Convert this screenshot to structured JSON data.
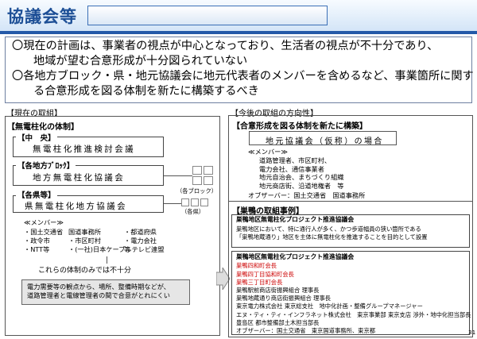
{
  "header": {
    "title": "協議会等"
  },
  "summary": {
    "bullet": "〇",
    "line1": "現在の計画は、事業者の視点が中心となっており、生活者の視点が不十分であり、",
    "line1_cont": "地域が望む合意形成が十分図られていない",
    "line2": "各地方ブロック・県・地元協議会に地元代表者のメンバーを含めるなど、事業箇所に関す",
    "line2_cont": "る合意形成を図る体制を新たに構築するべき"
  },
  "left": {
    "section_label": "【現在の取組】",
    "panel_title": "【無電柱化の体制】",
    "central": {
      "tag": "【中　央】",
      "body": "無電柱化推進検討会議"
    },
    "regional": {
      "tag": "【各地方ﾌﾞﾛｯｸ】",
      "body": "地方無電柱化協議会",
      "note": "（各ブロック）"
    },
    "prefecture": {
      "tag": "【各県等】",
      "body": "県無電柱化地方協議会",
      "note": "（各県）"
    },
    "members": {
      "heading": "≪メンバー≫",
      "rows": [
        [
          "・国土交通省",
          "国道事務所",
          "・都道府県"
        ],
        [
          "・政令市",
          "・市区町村",
          "・電力会社"
        ],
        [
          "・NTT等",
          "・(一社)日本ケーブルテレビ連盟",
          "等"
        ]
      ]
    },
    "insufficient": "これらの体制のみでは不十分",
    "problem_line1": "電力需要等の観点から、場所、整備時期などが、",
    "problem_line2": "道路管理者と電線管理者の間で合意がとれにくい"
  },
  "right": {
    "section_label": "【今後の取組の方向性】",
    "consensus": {
      "title": "【合意形成を図る体制を新たに構築】",
      "council_box": "地元協議会（仮称）の場合",
      "members_heading": "≪メンバー≫",
      "members": [
        "道路管理者、市区町村、",
        "電力会社、通信事業者",
        "地元自治会、まちづくり組織",
        "地元商店街、沿道地権者　等"
      ],
      "observer": "オブザーバー：国土交通省　国道事務所"
    },
    "example": {
      "title": "【巣鴨の取組事例】",
      "box1_title": "巣鴨地区無電柱化プロジェクト推進協議会",
      "box1_line1": "巣鴨地区において、特に通行人が多く、かつ歩道幅員の狭い箇所である",
      "box1_line2": "「巣鴨地蔵通り」地区を主体に無電柱化を推進することを目的として設置",
      "box2_title": "巣鴨地区無電柱化プロジェクト推進協議会",
      "box2_members": [
        "巣鴨四和町会長",
        "巣鴨四丁目協和町会長",
        "巣鴨三丁目町会長",
        "巣鴨駅前商店街振興組合 理事長",
        "巣鴨地蔵通り商店街振興組合 理事長",
        "東京電力株式会社 東京総支社　地中化計画・整備グループマネージャー",
        "エヌ・ティ・ティ・インフラネット株式会社　東京事業部 東京支店 渉外・地中化担当部長",
        "豊島区 都市整備部土木担当部長",
        "オブザーバー：国土交通省　東京国道事務所、東京都"
      ]
    }
  },
  "page_number": "31",
  "colors": {
    "header_blue": "#1d4f96",
    "accent_red": "#cc0000"
  }
}
